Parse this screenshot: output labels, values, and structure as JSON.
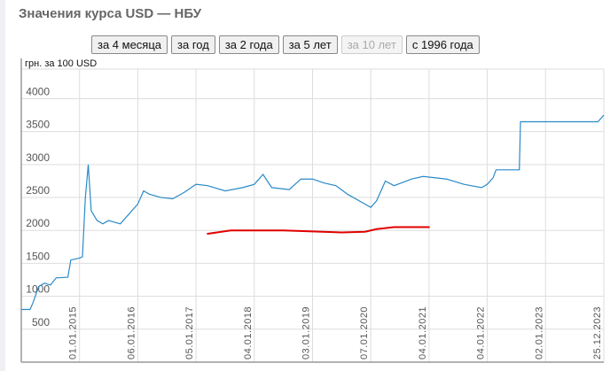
{
  "title": "Значения курса USD — НБУ",
  "buttons": [
    {
      "label": "за 4 месяца",
      "disabled": false
    },
    {
      "label": "за год",
      "disabled": false
    },
    {
      "label": "за 2 года",
      "disabled": false
    },
    {
      "label": "за 5 лет",
      "disabled": false
    },
    {
      "label": "за 10 лет",
      "disabled": true
    },
    {
      "label": "с 1996 года",
      "disabled": false
    }
  ],
  "chart_data": {
    "type": "line",
    "title": "Значения курса USD — НБУ",
    "ylabel": "грн. за 100 USD",
    "xlabel": "",
    "ylim": [
      0,
      4450
    ],
    "xlim": [
      2014.0,
      2024.0
    ],
    "yticks": [
      500,
      1000,
      1500,
      2000,
      2500,
      3000,
      3500,
      4000
    ],
    "xticks": [
      {
        "label": "01.01.2015",
        "x": 2015.0
      },
      {
        "label": "06.01.2016",
        "x": 2016.0
      },
      {
        "label": "05.01.2017",
        "x": 2017.0
      },
      {
        "label": "04.01.2018",
        "x": 2018.0
      },
      {
        "label": "03.01.2019",
        "x": 2019.0
      },
      {
        "label": "07.01.2020",
        "x": 2020.0
      },
      {
        "label": "04.01.2021",
        "x": 2021.0
      },
      {
        "label": "04.01.2022",
        "x": 2022.0
      },
      {
        "label": "02.01.2023",
        "x": 2023.0
      },
      {
        "label": "25.12.2023",
        "x": 2024.0
      }
    ],
    "grid": true,
    "series": [
      {
        "name": "USD",
        "color": "#2a8ac8",
        "points": [
          [
            2014.0,
            800
          ],
          [
            2014.15,
            800
          ],
          [
            2014.2,
            900
          ],
          [
            2014.3,
            1150
          ],
          [
            2014.4,
            1200
          ],
          [
            2014.5,
            1170
          ],
          [
            2014.6,
            1280
          ],
          [
            2014.8,
            1290
          ],
          [
            2014.85,
            1550
          ],
          [
            2015.0,
            1580
          ],
          [
            2015.05,
            1600
          ],
          [
            2015.1,
            2500
          ],
          [
            2015.15,
            3000
          ],
          [
            2015.2,
            2300
          ],
          [
            2015.3,
            2150
          ],
          [
            2015.4,
            2100
          ],
          [
            2015.5,
            2150
          ],
          [
            2015.7,
            2100
          ],
          [
            2015.9,
            2300
          ],
          [
            2016.0,
            2400
          ],
          [
            2016.1,
            2600
          ],
          [
            2016.2,
            2550
          ],
          [
            2016.4,
            2500
          ],
          [
            2016.6,
            2480
          ],
          [
            2016.8,
            2580
          ],
          [
            2017.0,
            2700
          ],
          [
            2017.2,
            2680
          ],
          [
            2017.5,
            2600
          ],
          [
            2017.8,
            2650
          ],
          [
            2018.0,
            2700
          ],
          [
            2018.15,
            2850
          ],
          [
            2018.3,
            2650
          ],
          [
            2018.6,
            2620
          ],
          [
            2018.8,
            2780
          ],
          [
            2019.0,
            2780
          ],
          [
            2019.2,
            2720
          ],
          [
            2019.4,
            2680
          ],
          [
            2019.6,
            2550
          ],
          [
            2019.9,
            2400
          ],
          [
            2020.0,
            2350
          ],
          [
            2020.1,
            2450
          ],
          [
            2020.25,
            2750
          ],
          [
            2020.4,
            2680
          ],
          [
            2020.7,
            2780
          ],
          [
            2020.9,
            2820
          ],
          [
            2021.1,
            2800
          ],
          [
            2021.3,
            2780
          ],
          [
            2021.6,
            2700
          ],
          [
            2021.9,
            2650
          ],
          [
            2022.0,
            2700
          ],
          [
            2022.1,
            2800
          ],
          [
            2022.15,
            2920
          ],
          [
            2022.55,
            2920
          ],
          [
            2022.57,
            3650
          ],
          [
            2023.9,
            3650
          ],
          [
            2023.95,
            3700
          ],
          [
            2024.0,
            3750
          ]
        ]
      }
    ],
    "annotation_line": {
      "color": "#e00000",
      "points": [
        [
          2017.2,
          1950
        ],
        [
          2017.6,
          2000
        ],
        [
          2018.5,
          2000
        ],
        [
          2019.5,
          1970
        ],
        [
          2019.9,
          1980
        ],
        [
          2020.1,
          2020
        ],
        [
          2020.4,
          2050
        ],
        [
          2021.0,
          2050
        ]
      ]
    }
  }
}
